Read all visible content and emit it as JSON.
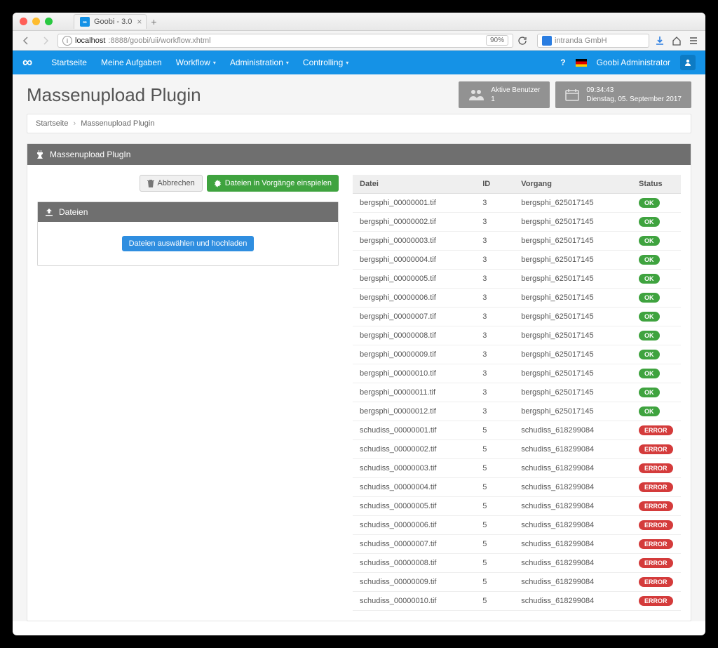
{
  "browser": {
    "tab_title": "Goobi - 3.0",
    "url_host": "localhost",
    "url_port_path": ":8888/goobi/uii/workflow.xhtml",
    "zoom": "90%",
    "search_placeholder": "intranda GmbH"
  },
  "nav": {
    "items": [
      "Startseite",
      "Meine Aufgaben",
      "Workflow",
      "Administration",
      "Controlling"
    ],
    "dropdown": [
      false,
      false,
      true,
      true,
      true
    ],
    "help": "?",
    "user": "Goobi Administrator"
  },
  "header": {
    "title": "Massenupload Plugin",
    "active_users_label": "Aktive Benutzer",
    "active_users_count": "1",
    "time": "09:34:43",
    "date": "Dienstag, 05. September 2017"
  },
  "breadcrumb": {
    "home": "Startseite",
    "current": "Massenupload Plugin"
  },
  "panel": {
    "title": "Massenupload PlugIn",
    "cancel": "Abbrechen",
    "import": "Dateien in Vorgänge einspielen",
    "files_title": "Dateien",
    "upload_btn": "Dateien auswählen und hochladen"
  },
  "table": {
    "cols": {
      "file": "Datei",
      "id": "ID",
      "process": "Vorgang",
      "status": "Status"
    },
    "status_ok": "OK",
    "status_err": "ERROR",
    "rows": [
      {
        "file": "bergsphi_00000001.tif",
        "id": "3",
        "process": "bergsphi_625017145",
        "ok": true
      },
      {
        "file": "bergsphi_00000002.tif",
        "id": "3",
        "process": "bergsphi_625017145",
        "ok": true
      },
      {
        "file": "bergsphi_00000003.tif",
        "id": "3",
        "process": "bergsphi_625017145",
        "ok": true
      },
      {
        "file": "bergsphi_00000004.tif",
        "id": "3",
        "process": "bergsphi_625017145",
        "ok": true
      },
      {
        "file": "bergsphi_00000005.tif",
        "id": "3",
        "process": "bergsphi_625017145",
        "ok": true
      },
      {
        "file": "bergsphi_00000006.tif",
        "id": "3",
        "process": "bergsphi_625017145",
        "ok": true
      },
      {
        "file": "bergsphi_00000007.tif",
        "id": "3",
        "process": "bergsphi_625017145",
        "ok": true
      },
      {
        "file": "bergsphi_00000008.tif",
        "id": "3",
        "process": "bergsphi_625017145",
        "ok": true
      },
      {
        "file": "bergsphi_00000009.tif",
        "id": "3",
        "process": "bergsphi_625017145",
        "ok": true
      },
      {
        "file": "bergsphi_00000010.tif",
        "id": "3",
        "process": "bergsphi_625017145",
        "ok": true
      },
      {
        "file": "bergsphi_00000011.tif",
        "id": "3",
        "process": "bergsphi_625017145",
        "ok": true
      },
      {
        "file": "bergsphi_00000012.tif",
        "id": "3",
        "process": "bergsphi_625017145",
        "ok": true
      },
      {
        "file": "schudiss_00000001.tif",
        "id": "5",
        "process": "schudiss_618299084",
        "ok": false
      },
      {
        "file": "schudiss_00000002.tif",
        "id": "5",
        "process": "schudiss_618299084",
        "ok": false
      },
      {
        "file": "schudiss_00000003.tif",
        "id": "5",
        "process": "schudiss_618299084",
        "ok": false
      },
      {
        "file": "schudiss_00000004.tif",
        "id": "5",
        "process": "schudiss_618299084",
        "ok": false
      },
      {
        "file": "schudiss_00000005.tif",
        "id": "5",
        "process": "schudiss_618299084",
        "ok": false
      },
      {
        "file": "schudiss_00000006.tif",
        "id": "5",
        "process": "schudiss_618299084",
        "ok": false
      },
      {
        "file": "schudiss_00000007.tif",
        "id": "5",
        "process": "schudiss_618299084",
        "ok": false
      },
      {
        "file": "schudiss_00000008.tif",
        "id": "5",
        "process": "schudiss_618299084",
        "ok": false
      },
      {
        "file": "schudiss_00000009.tif",
        "id": "5",
        "process": "schudiss_618299084",
        "ok": false
      },
      {
        "file": "schudiss_00000010.tif",
        "id": "5",
        "process": "schudiss_618299084",
        "ok": false
      }
    ]
  }
}
